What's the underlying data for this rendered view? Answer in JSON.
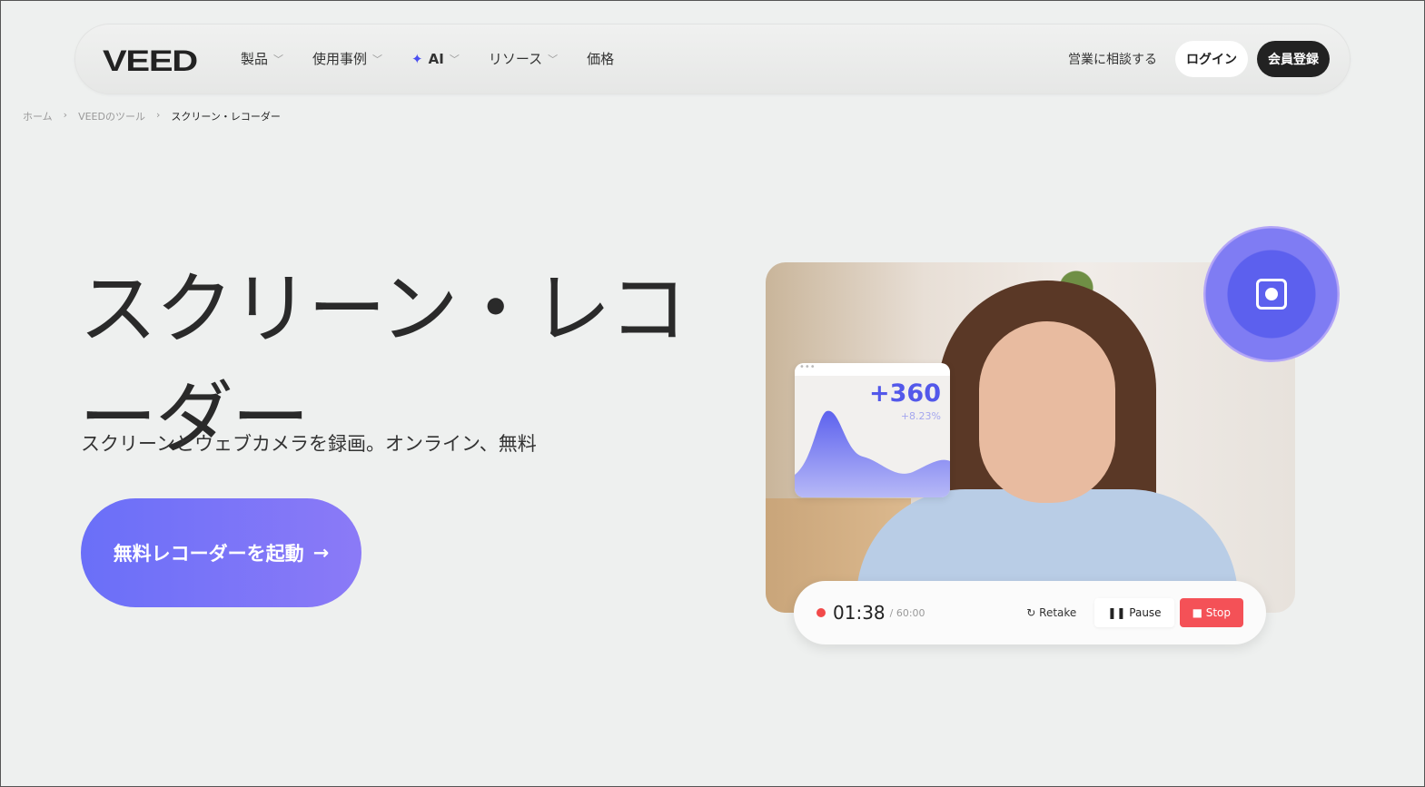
{
  "nav": {
    "logo": "VEED",
    "items": [
      {
        "label": "製品"
      },
      {
        "label": "使用事例"
      },
      {
        "label": "AI"
      },
      {
        "label": "リソース"
      },
      {
        "label": "価格"
      }
    ],
    "sales": "営業に相談する",
    "login": "ログイン",
    "signup": "会員登録"
  },
  "breadcrumb": {
    "home": "ホーム",
    "tools": "VEEDのツール",
    "current": "スクリーン・レコーダー"
  },
  "hero": {
    "title": "スクリーン・レコーダー",
    "subtitle": "スクリーンとウェブカメラを録画。オンライン、無料",
    "cta": "無料レコーダーを起動"
  },
  "widget": {
    "stat_value": "+360",
    "stat_change": "+8.23%",
    "dots": "•••"
  },
  "recorder": {
    "time": "01:38",
    "total": "/ 60:00",
    "retake": "Retake",
    "pause": "Pause",
    "stop": "Stop"
  },
  "colors": {
    "accent": "#6a6ff8",
    "stop": "#f45157",
    "dark": "#222222"
  }
}
